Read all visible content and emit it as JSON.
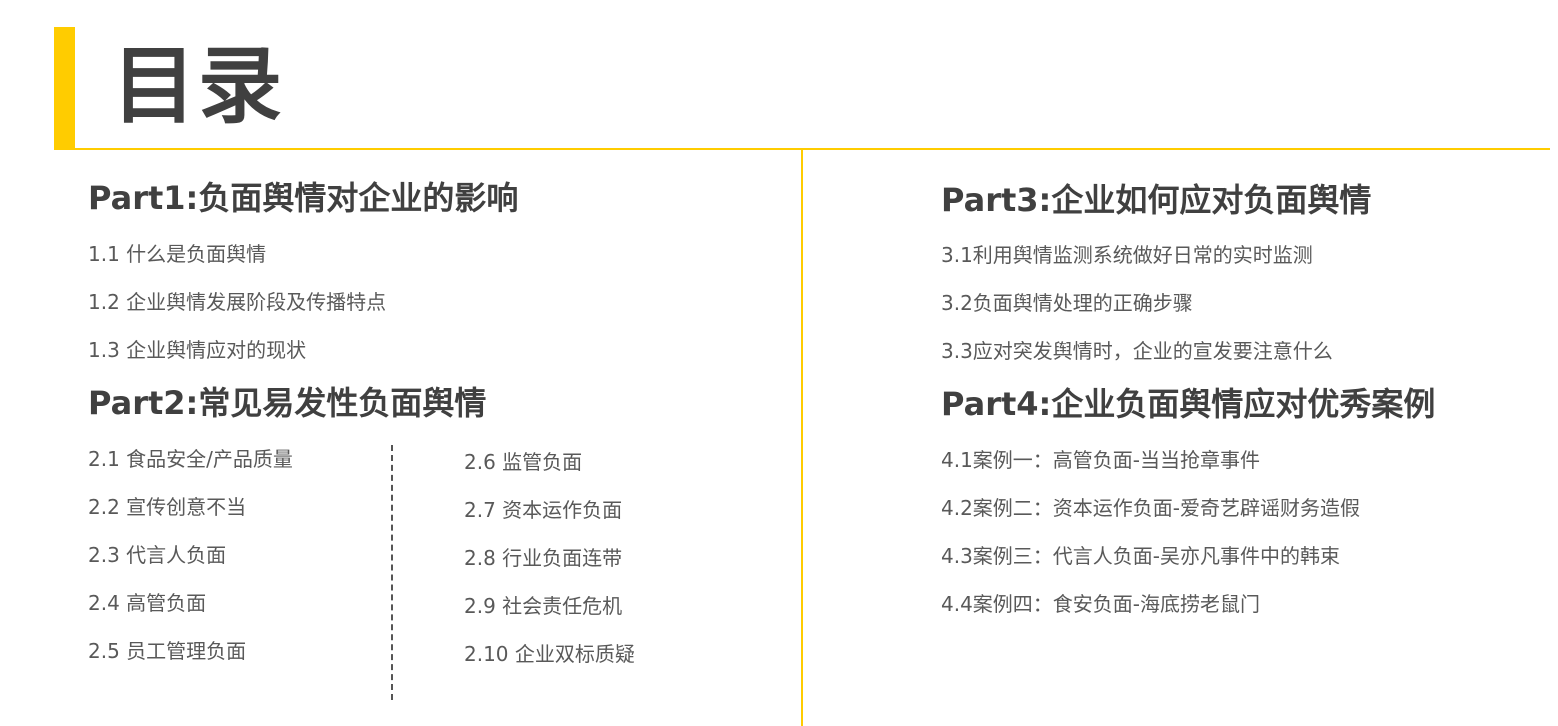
{
  "title": "目录",
  "colors": {
    "accent": "#FFCC00",
    "heading_text": "#404040",
    "item_text": "#595959"
  },
  "part1": {
    "heading": "Part1:负面舆情对企业的影响",
    "items": [
      "1.1  什么是负面舆情",
      "1.2  企业舆情发展阶段及传播特点",
      "1.3  企业舆情应对的现状"
    ]
  },
  "part2": {
    "heading": "Part2:常见易发性负面舆情",
    "items_left": [
      "2.1  食品安全/产品质量",
      "2.2  宣传创意不当",
      "2.3  代言人负面",
      "2.4  高管负面",
      "2.5  员工管理负面"
    ],
    "items_right": [
      "2.6  监管负面",
      "2.7  资本运作负面",
      "2.8  行业负面连带",
      "2.9  社会责任危机",
      "2.10  企业双标质疑"
    ]
  },
  "part3": {
    "heading": "Part3:企业如何应对负面舆情",
    "items": [
      "3.1利用舆情监测系统做好日常的实时监测",
      "3.2负面舆情处理的正确步骤",
      "3.3应对突发舆情时，企业的宣发要注意什么"
    ]
  },
  "part4": {
    "heading": "Part4:企业负面舆情应对优秀案例",
    "items": [
      "4.1案例一：高管负面-当当抢章事件",
      "4.2案例二：资本运作负面-爱奇艺辟谣财务造假",
      "4.3案例三：代言人负面-吴亦凡事件中的韩束",
      "4.4案例四：食安负面-海底捞老鼠门"
    ]
  }
}
